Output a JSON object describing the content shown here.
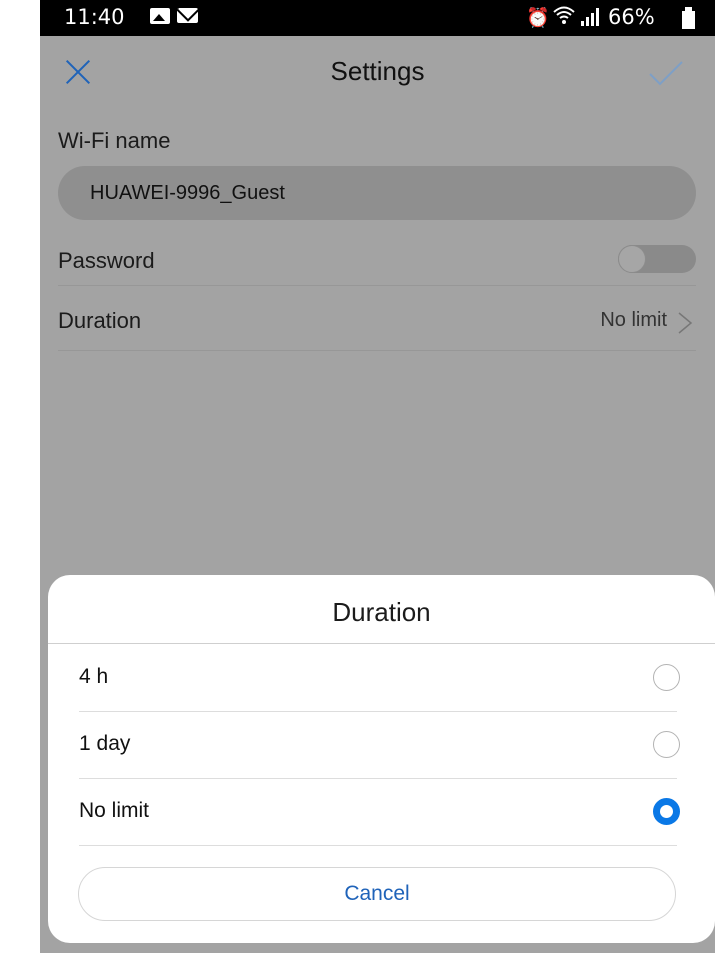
{
  "status_bar": {
    "time": "11:40",
    "battery_percent": "66%",
    "icons": [
      "image-icon",
      "mail-icon",
      "alarm-icon",
      "wifi-icon",
      "signal-icon",
      "battery-icon"
    ]
  },
  "header": {
    "title": "Settings",
    "close_icon": "close-icon",
    "confirm_icon": "check-icon"
  },
  "form": {
    "wifi_name_label": "Wi-Fi name",
    "wifi_name_value": "HUAWEI-9996_Guest",
    "password_label": "Password",
    "password_enabled": false,
    "duration_label": "Duration",
    "duration_value": "No limit"
  },
  "duration_dialog": {
    "title": "Duration",
    "options": [
      {
        "label": "4 h",
        "selected": false
      },
      {
        "label": "1 day",
        "selected": false
      },
      {
        "label": "No limit",
        "selected": true
      }
    ],
    "cancel_label": "Cancel"
  },
  "colors": {
    "accent": "#0a78e6",
    "link": "#1f63b9",
    "scrim": "#a3a3a3"
  }
}
